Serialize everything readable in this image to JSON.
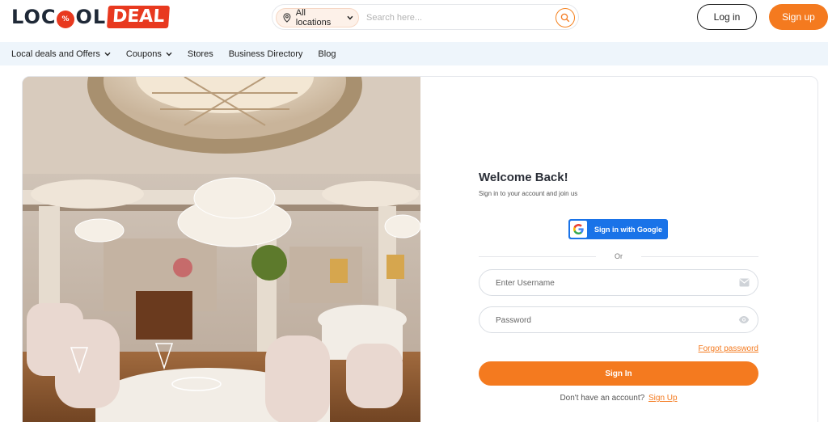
{
  "header": {
    "logo": {
      "part1": "LOC",
      "part2": "OL",
      "part3": "DEAL",
      "badge": "%"
    },
    "location": {
      "label": "All locations"
    },
    "search": {
      "placeholder": "Search here..."
    },
    "login_label": "Log in",
    "signup_label": "Sign up"
  },
  "nav": {
    "items": [
      {
        "label": "Local deals and Offers",
        "dropdown": true
      },
      {
        "label": "Coupons",
        "dropdown": true
      },
      {
        "label": "Stores",
        "dropdown": false
      },
      {
        "label": "Business Directory",
        "dropdown": false
      },
      {
        "label": "Blog",
        "dropdown": false
      }
    ]
  },
  "form": {
    "title": "Welcome Back!",
    "subtitle": "Sign in to your account and join us",
    "google_label": "Sign in with Google",
    "or_label": "Or",
    "username_placeholder": "Enter Username",
    "password_placeholder": "Password",
    "forgot_label": "Forgot password",
    "signin_label": "Sign In",
    "no_account_text": "Don't have an account?",
    "signup_link": "Sign Up"
  },
  "colors": {
    "accent": "#f47a1f",
    "logo_red": "#e8391f",
    "google_blue": "#1a73e8",
    "nav_bg": "#eef5fb"
  },
  "icons": [
    "location-pin-icon",
    "chevron-down-icon",
    "search-icon",
    "google-icon",
    "envelope-icon",
    "eye-icon"
  ]
}
